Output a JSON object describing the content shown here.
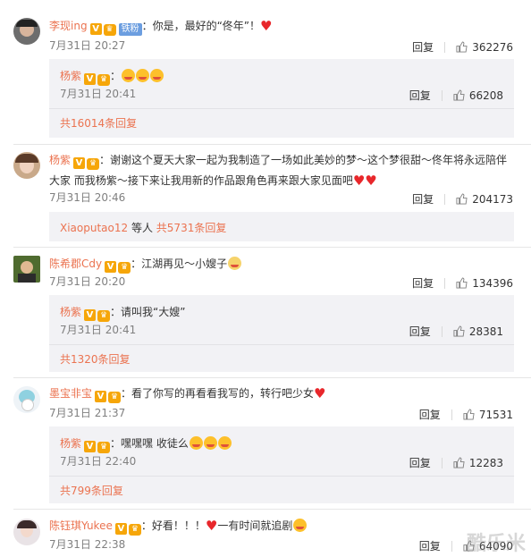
{
  "comments": [
    {
      "user": "李现ing",
      "badge": "铁粉",
      "text": "：你是，最好的“佟年”！",
      "time": "7月31日 20:27",
      "reply": "回复",
      "likes": "362276",
      "sub": {
        "user": "杨紫",
        "text": "",
        "time": "7月31日 20:41",
        "reply": "回复",
        "likes": "66208"
      },
      "more": "共16014条回复"
    },
    {
      "user": "杨紫",
      "text_line1": "：谢谢这个夏天大家一起为我制造了一场如此美妙的梦～这个梦很甜～佟年将永远陪伴",
      "text_line2": "大家 而我杨紫～接下来让我用新的作品跟角色再来跟大家见面吧",
      "time": "7月31日 20:46",
      "reply": "回复",
      "likes": "204173",
      "more_user": "Xiaoputao12",
      "more_mid": " 等人 ",
      "more": "共5731条回复"
    },
    {
      "user": "陈希郡Cdy",
      "text": "：江湖再见～小嫂子",
      "time": "7月31日 20:20",
      "reply": "回复",
      "likes": "134396",
      "sub": {
        "user": "杨紫",
        "text": "：请叫我“大嫂”",
        "time": "7月31日 20:41",
        "reply": "回复",
        "likes": "28381"
      },
      "more": "共1320条回复"
    },
    {
      "user": "墨宝非宝",
      "text": "：看了你写的再看看我写的，转行吧少女",
      "time": "7月31日 21:37",
      "reply": "回复",
      "likes": "71531",
      "sub": {
        "user": "杨紫",
        "text": "：嘿嘿嘿 收徒么",
        "time": "7月31日 22:40",
        "reply": "回复",
        "likes": "12283"
      },
      "more": "共799条回复"
    },
    {
      "user": "陈钰琪Yukee",
      "text": "：好看！！！",
      "text2": "一有时间就追剧",
      "time": "7月31日 22:38",
      "reply": "回复",
      "likes": "64090"
    }
  ],
  "watermark": "酷乐米",
  "icons": {
    "verified": "V",
    "thumb": "thumb-up-icon",
    "heart": "heart-icon"
  },
  "colors": {
    "name": "#eb7350",
    "verified": "#f6a609",
    "sub_bg": "#f2f2f5"
  }
}
